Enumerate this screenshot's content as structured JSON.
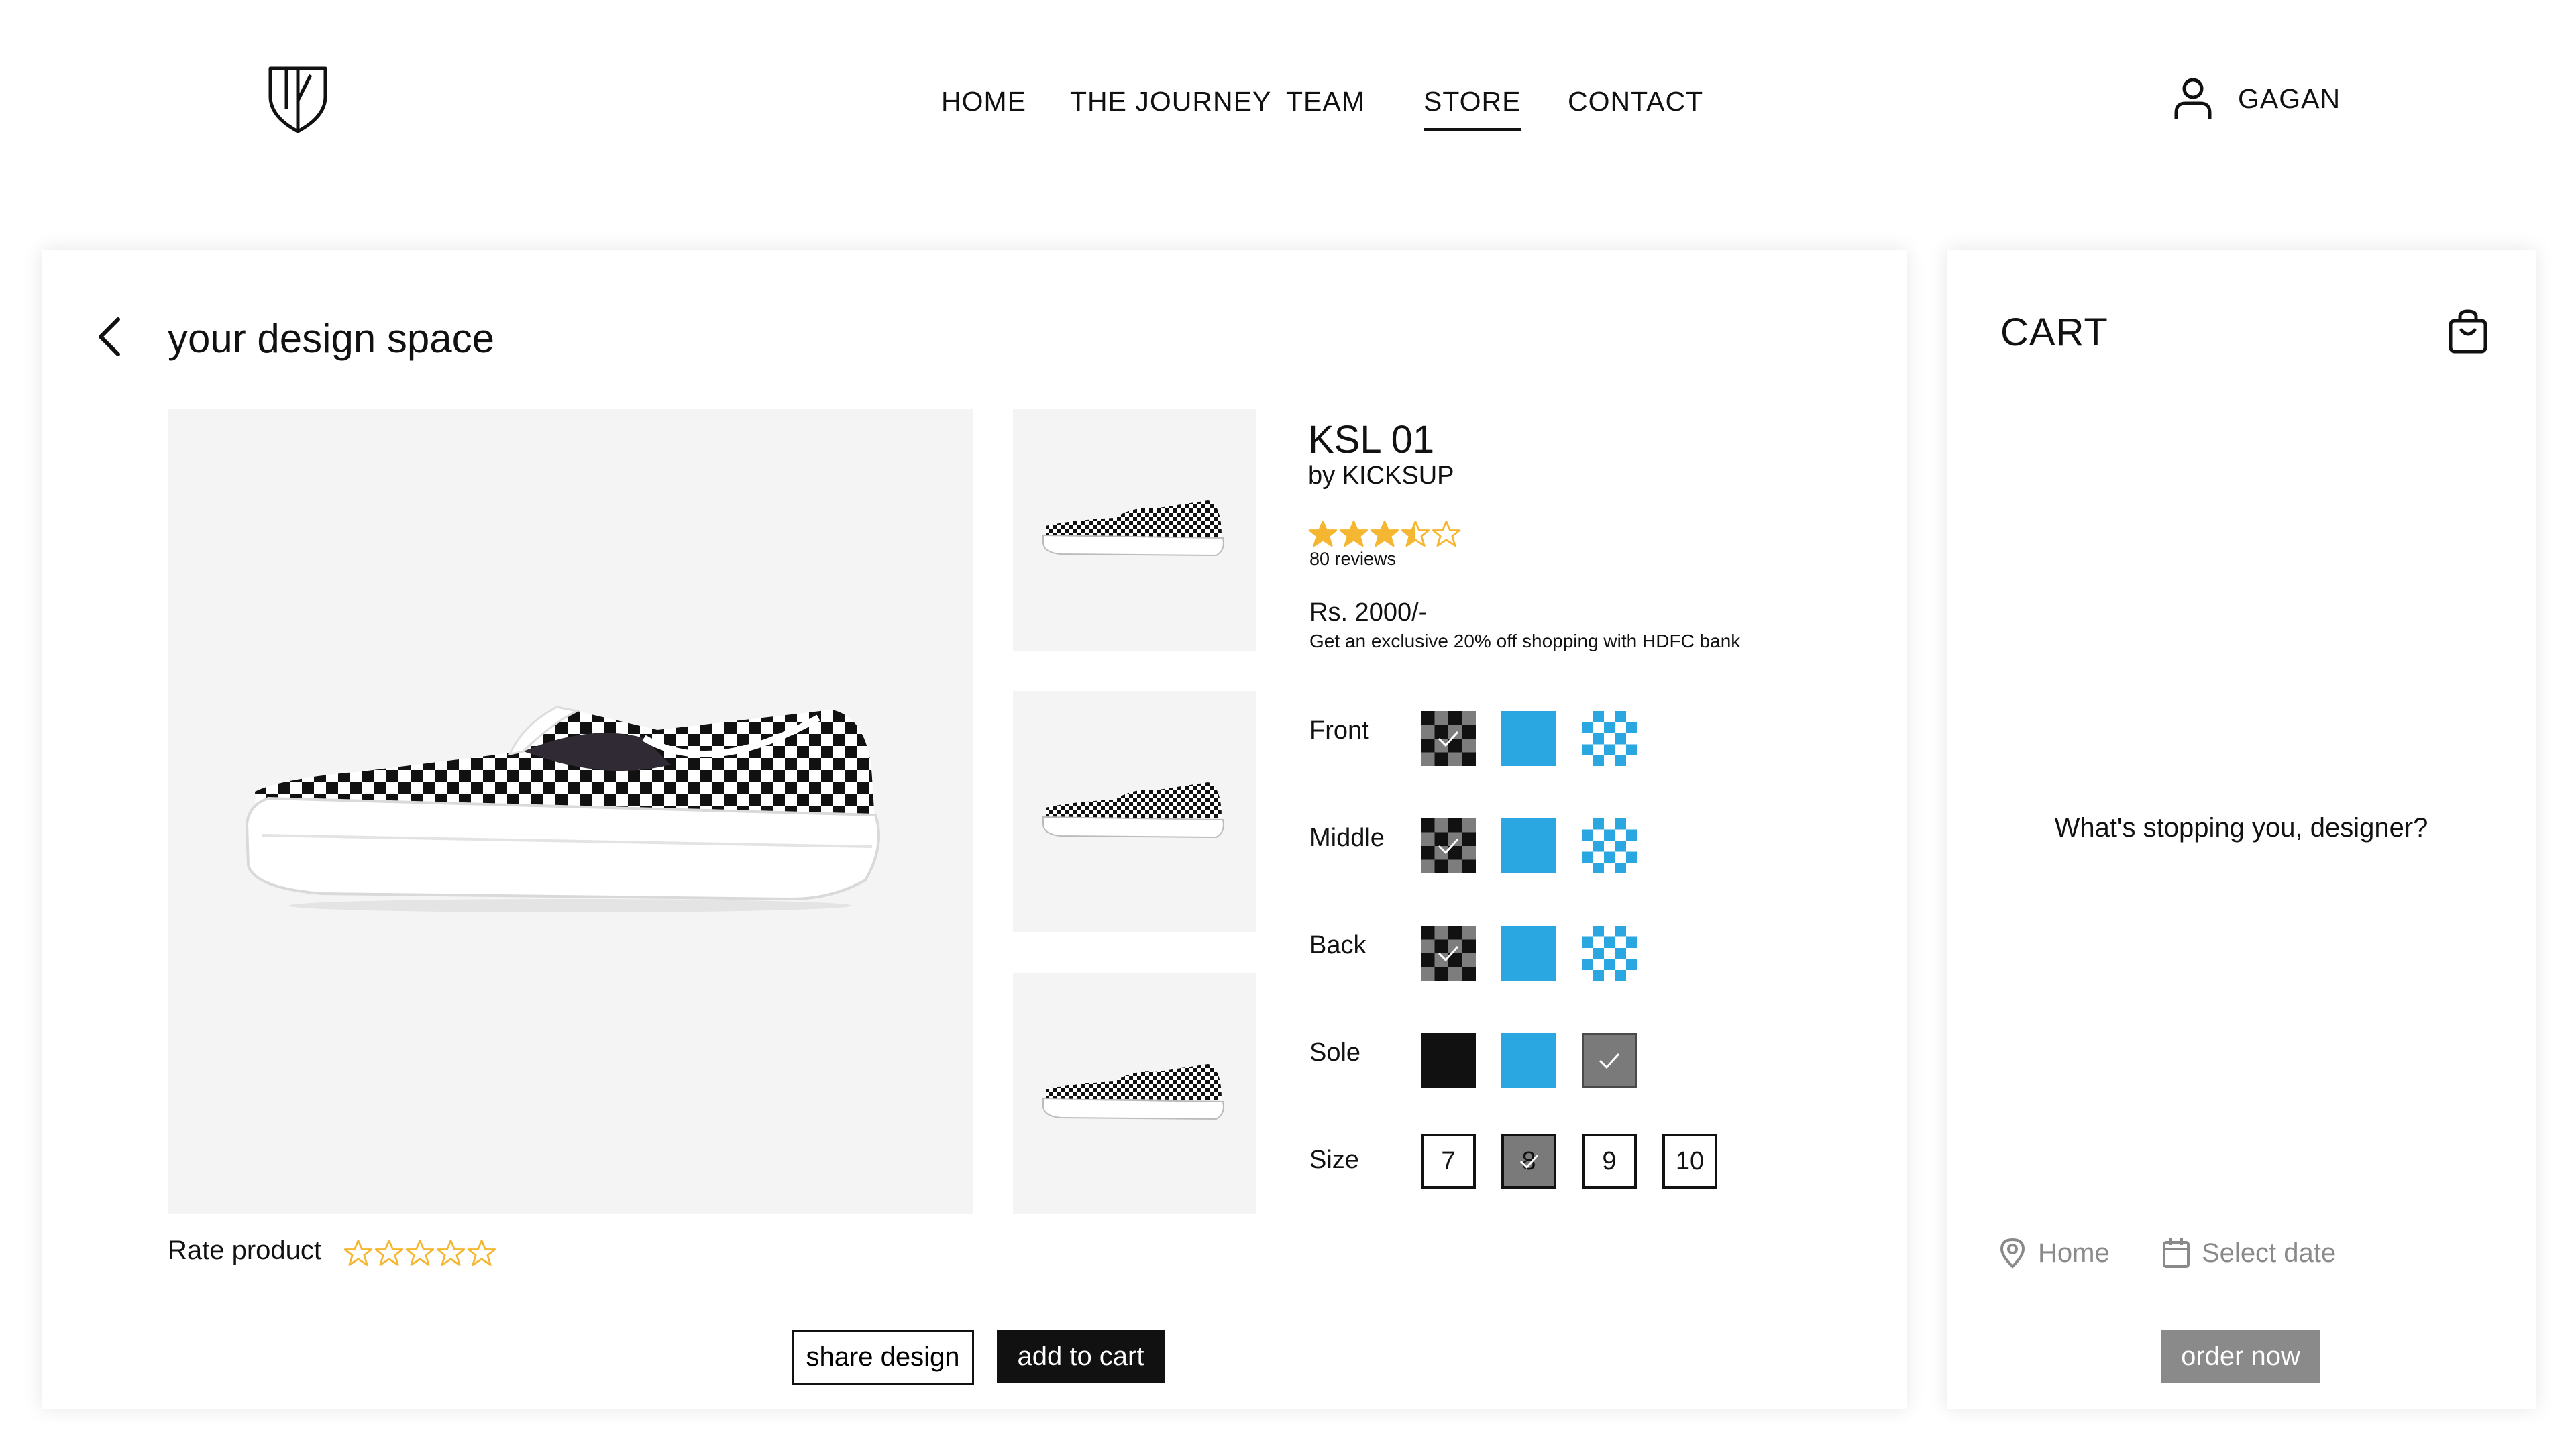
{
  "header": {
    "nav": [
      "HOME",
      "THE JOURNEY",
      "TEAM",
      "STORE",
      "CONTACT"
    ],
    "active_nav": "STORE",
    "user_name": "GAGAN"
  },
  "design": {
    "title": "your design space",
    "product": {
      "name": "KSL 01",
      "brand": "by KICKSUP",
      "rating": 3.5,
      "rating_max": 5,
      "reviews": "80 reviews",
      "price": "Rs. 2000/-",
      "offer": "Get an exclusive 20% off shopping with HDFC bank"
    },
    "options": [
      {
        "label": "Front",
        "swatches": [
          "checker-bw",
          "blue",
          "checker-blue"
        ],
        "selected": 0
      },
      {
        "label": "Middle",
        "swatches": [
          "checker-bw",
          "blue",
          "checker-blue"
        ],
        "selected": 0
      },
      {
        "label": "Back",
        "swatches": [
          "checker-bw",
          "blue",
          "checker-blue"
        ],
        "selected": 0
      },
      {
        "label": "Sole",
        "swatches": [
          "black",
          "blue",
          "grey"
        ],
        "selected": 2
      }
    ],
    "size": {
      "label": "Size",
      "values": [
        "7",
        "8",
        "9",
        "10"
      ],
      "selected": "8"
    },
    "rate_label": "Rate product",
    "rate_value": 0,
    "share_label": "share design",
    "add_label": "add to cart"
  },
  "cart": {
    "title": "CART",
    "empty_message": "What's stopping you, designer?",
    "location": "Home",
    "date_placeholder": "Select date",
    "order_label": "order now"
  },
  "colors": {
    "accent_blue": "#2aa6e0",
    "star_gold": "#f5b731",
    "grey": "#8a8a8a",
    "dark": "#111111"
  }
}
